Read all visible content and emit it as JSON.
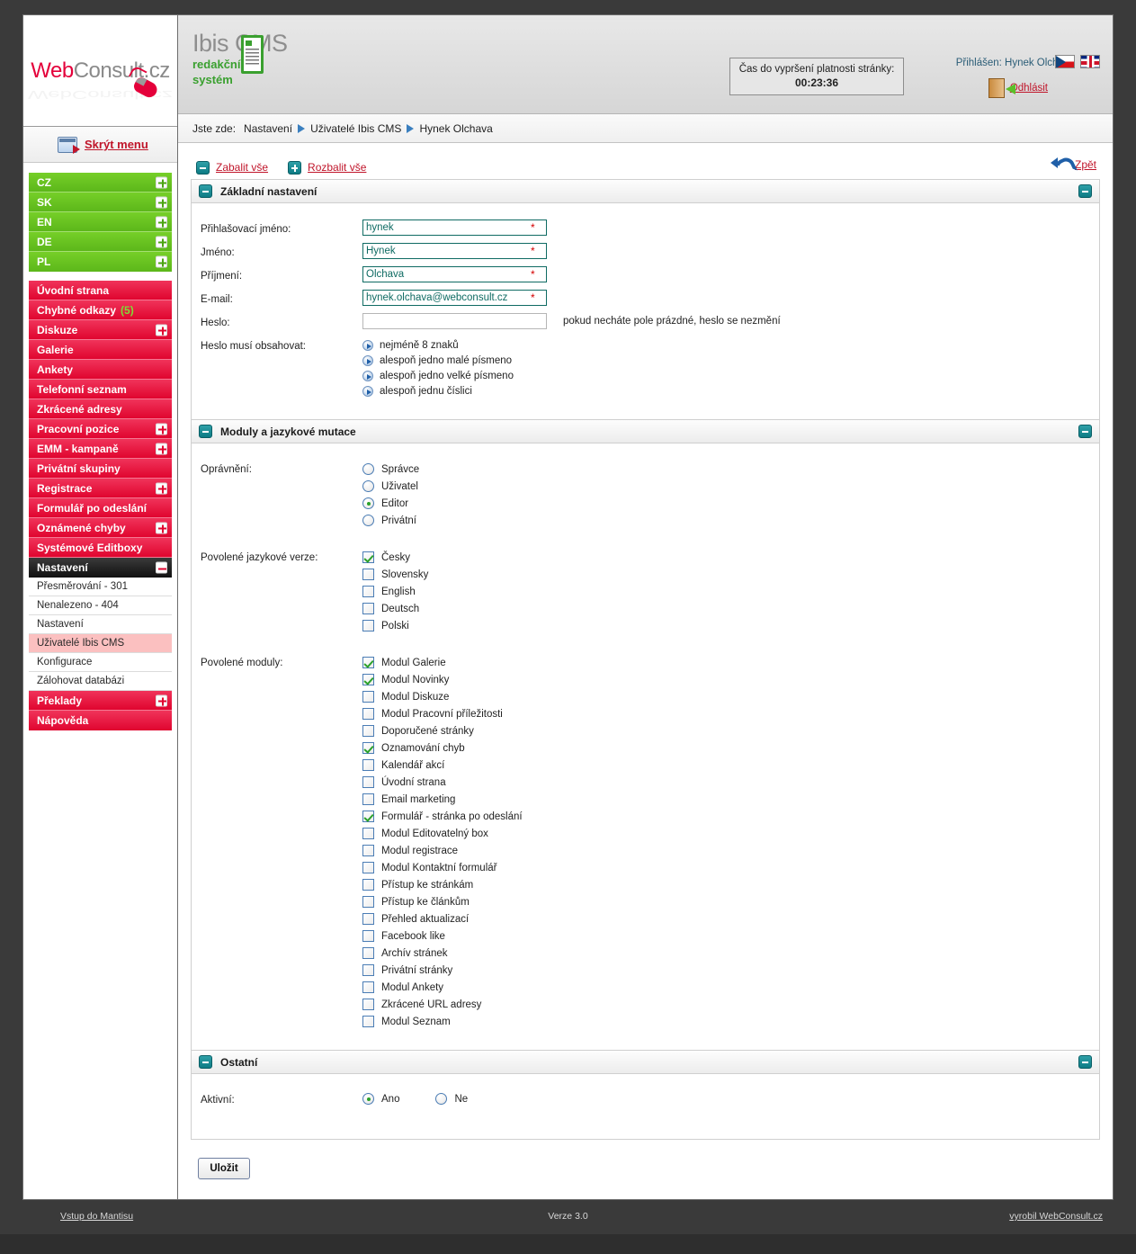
{
  "brand": {
    "logo_web": "Web",
    "logo_consult": "Consult",
    "logo_cz": ".cz",
    "logo_full": "WebConsult.cz",
    "cms_name": "Ibis CMS",
    "cms_sub_line1": "redakční",
    "cms_sub_line2": "systém"
  },
  "header": {
    "timer_label": "Čas do vypršení platnosti stránky:",
    "timer_value": "00:23:36",
    "logged_in": "Přihlášen: Hynek Olchava",
    "logout": "Odhlásit",
    "flag_cz": "flag-cz-icon",
    "flag_en": "flag-uk-icon"
  },
  "breadcrumb": {
    "prefix": "Jste zde:",
    "items": [
      "Nastavení",
      "Uživatelé Ibis CMS",
      "Hynek Olchava"
    ]
  },
  "sidebar": {
    "hide_menu": "Skrýt menu",
    "languages": [
      {
        "label": "CZ",
        "expander": "plus"
      },
      {
        "label": "SK",
        "expander": "plus"
      },
      {
        "label": "EN",
        "expander": "plus"
      },
      {
        "label": "DE",
        "expander": "plus"
      },
      {
        "label": "PL",
        "expander": "plus"
      }
    ],
    "sections": [
      {
        "label": "Úvodní strana",
        "expander": null
      },
      {
        "label": "Chybné odkazy",
        "badge": "(5)",
        "expander": null
      },
      {
        "label": "Diskuze",
        "expander": "plus"
      },
      {
        "label": "Galerie",
        "expander": null
      },
      {
        "label": "Ankety",
        "expander": null
      },
      {
        "label": "Telefonní seznam",
        "expander": null
      },
      {
        "label": "Zkrácené adresy",
        "expander": null
      },
      {
        "label": "Pracovní pozice",
        "expander": "plus"
      },
      {
        "label": "EMM - kampaně",
        "expander": "plus"
      },
      {
        "label": "Privátní skupiny",
        "expander": null
      },
      {
        "label": "Registrace",
        "expander": "plus"
      },
      {
        "label": "Formulář po odeslání",
        "expander": null
      },
      {
        "label": "Oznámené chyby",
        "expander": "plus"
      },
      {
        "label": "Systémové Editboxy",
        "expander": null
      }
    ],
    "active_section": {
      "label": "Nastavení",
      "expander": "minus"
    },
    "sub_items": [
      {
        "label": "Přesměrování - 301",
        "active": false
      },
      {
        "label": "Nenalezeno - 404",
        "active": false
      },
      {
        "label": "Nastavení",
        "active": false
      },
      {
        "label": "Uživatelé Ibis CMS",
        "active": true
      },
      {
        "label": "Konfigurace",
        "active": false
      },
      {
        "label": "Zálohovat databázi",
        "active": false
      }
    ],
    "tail_sections": [
      {
        "label": "Překlady",
        "expander": "plus"
      },
      {
        "label": "Nápověda",
        "expander": null
      }
    ]
  },
  "toolbar": {
    "collapse_all": "Zabalit vše",
    "expand_all": "Rozbalit vše",
    "back": "Zpět"
  },
  "panels": {
    "basic": {
      "title": "Základní nastavení",
      "fields": [
        {
          "label": "Přihlašovací jméno:",
          "value": "hynek",
          "required": true
        },
        {
          "label": "Jméno:",
          "value": "Hynek",
          "required": true
        },
        {
          "label": "Příjmení:",
          "value": "Olchava",
          "required": true
        },
        {
          "label": "E-mail:",
          "value": "hynek.olchava@webconsult.cz",
          "required": true
        }
      ],
      "password": {
        "label": "Heslo:",
        "value": "",
        "hint": "pokud necháte pole prázdné, heslo se nezmění"
      },
      "password_rules_label": "Heslo musí obsahovat:",
      "password_rules": [
        "nejméně 8 znaků",
        "alespoň jedno malé písmeno",
        "alespoň jedno velké písmeno",
        "alespoň jednu číslici"
      ]
    },
    "modules": {
      "title": "Moduly a jazykové mutace",
      "permissions_label": "Oprávnění:",
      "permissions": [
        {
          "label": "Správce",
          "selected": false
        },
        {
          "label": "Uživatel",
          "selected": false
        },
        {
          "label": "Editor",
          "selected": true
        },
        {
          "label": "Privátní",
          "selected": false
        }
      ],
      "languages_label": "Povolené jazykové verze:",
      "languages": [
        {
          "label": "Česky",
          "checked": true
        },
        {
          "label": "Slovensky",
          "checked": false
        },
        {
          "label": "English",
          "checked": false
        },
        {
          "label": "Deutsch",
          "checked": false
        },
        {
          "label": "Polski",
          "checked": false
        }
      ],
      "modules_label": "Povolené moduly:",
      "modules": [
        {
          "label": "Modul Galerie",
          "checked": true
        },
        {
          "label": "Modul Novinky",
          "checked": true
        },
        {
          "label": "Modul Diskuze",
          "checked": false
        },
        {
          "label": "Modul Pracovní příležitosti",
          "checked": false
        },
        {
          "label": "Doporučené stránky",
          "checked": false
        },
        {
          "label": "Oznamování chyb",
          "checked": true
        },
        {
          "label": "Kalendář akcí",
          "checked": false
        },
        {
          "label": "Úvodní strana",
          "checked": false
        },
        {
          "label": "Email marketing",
          "checked": false
        },
        {
          "label": "Formulář - stránka po odeslání",
          "checked": true
        },
        {
          "label": "Modul Editovatelný box",
          "checked": false
        },
        {
          "label": "Modul registrace",
          "checked": false
        },
        {
          "label": "Modul Kontaktní formulář",
          "checked": false
        },
        {
          "label": "Přístup ke stránkám",
          "checked": false
        },
        {
          "label": "Přístup ke článkům",
          "checked": false
        },
        {
          "label": "Přehled aktualizací",
          "checked": false
        },
        {
          "label": "Facebook like",
          "checked": false
        },
        {
          "label": "Archív stránek",
          "checked": false
        },
        {
          "label": "Privátní stránky",
          "checked": false
        },
        {
          "label": "Modul Ankety",
          "checked": false
        },
        {
          "label": "Zkrácené URL adresy",
          "checked": false
        },
        {
          "label": "Modul Seznam",
          "checked": false
        }
      ]
    },
    "other": {
      "title": "Ostatní",
      "active_label": "Aktivní:",
      "active_options": [
        {
          "label": "Ano",
          "selected": true
        },
        {
          "label": "Ne",
          "selected": false
        }
      ]
    }
  },
  "actions": {
    "save": "Uložit"
  },
  "footer": {
    "left": "Vstup do Mantisu",
    "center": "Verze 3.0",
    "right": "vyrobil WebConsult.cz"
  },
  "colors": {
    "accent_red": "#e0052f",
    "accent_green": "#5cb71a",
    "teal": "#0d7b84",
    "link_red": "#c0152a",
    "input_border": "#0f6b63"
  }
}
